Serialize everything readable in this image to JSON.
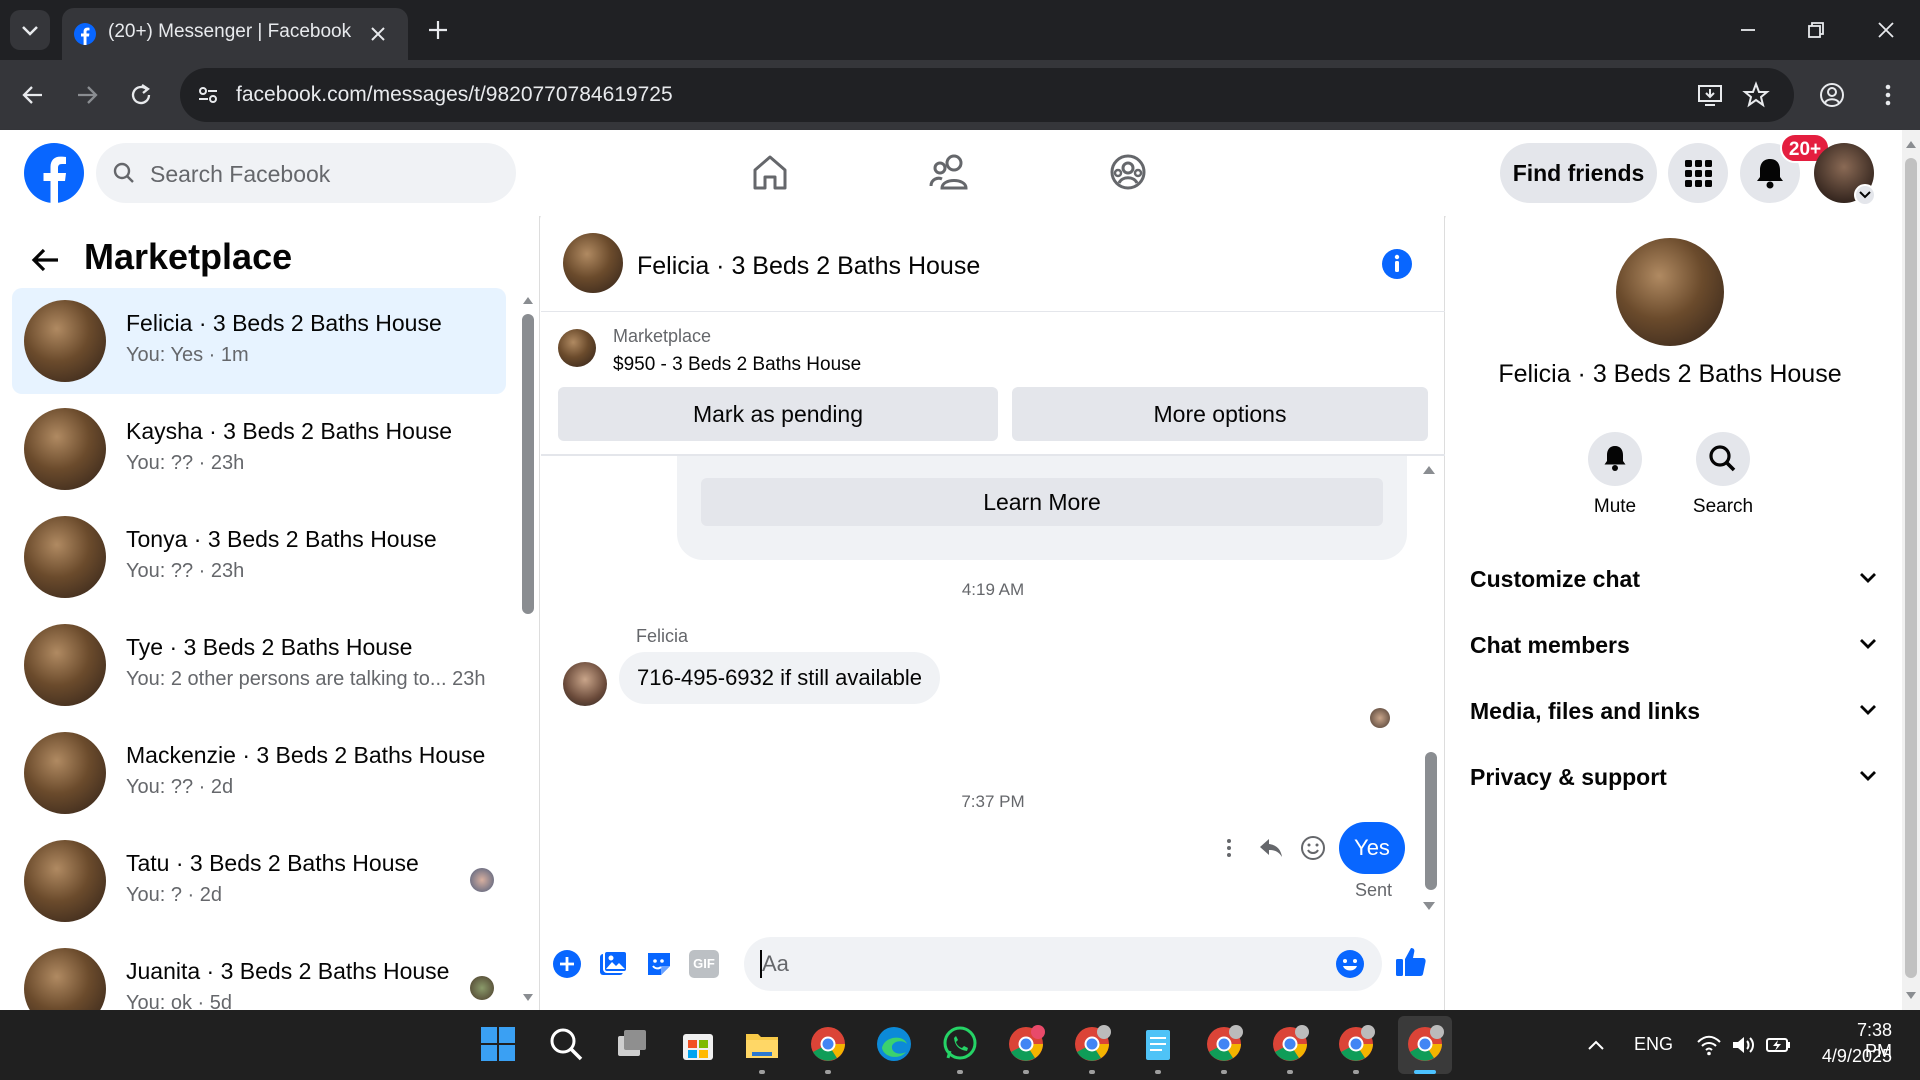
{
  "browser": {
    "tab_title": "(20+) Messenger | Facebook",
    "url": "facebook.com/messages/t/9820770784619725"
  },
  "header": {
    "search_placeholder": "Search Facebook",
    "find_friends": "Find friends",
    "notification_count": "20+"
  },
  "left_panel": {
    "heading": "Marketplace",
    "conversations": [
      {
        "name": "Felicia · 3 Beds 2 Baths House",
        "preview": "You: Yes · 1m",
        "active": true
      },
      {
        "name": "Kaysha · 3 Beds 2 Baths House",
        "preview": "You: ?? · 23h"
      },
      {
        "name": "Tonya · 3 Beds 2 Baths House",
        "preview": "You: ?? · 23h"
      },
      {
        "name": "Tye · 3 Beds 2 Baths House",
        "preview": "You: 2 other persons are talking to... 23h"
      },
      {
        "name": "Mackenzie · 3 Beds 2 Baths House",
        "preview": "You: ?? · 2d"
      },
      {
        "name": "Tatu · 3 Beds 2 Baths House",
        "preview": "You: ? · 2d"
      },
      {
        "name": "Juanita · 3 Beds 2 Baths House",
        "preview": "You: ok · 5d"
      }
    ]
  },
  "chat": {
    "title": "Felicia · 3 Beds 2 Baths House",
    "marketplace_label": "Marketplace",
    "listing": "$950 - 3 Beds 2 Baths House",
    "mark_pending": "Mark as pending",
    "more_options": "More options",
    "learn_more": "Learn More",
    "time1": "4:19 AM",
    "sender": "Felicia",
    "incoming_message": "716-495-6932 if still available",
    "time2": "7:37 PM",
    "outgoing_message": "Yes",
    "sent_status": "Sent",
    "composer_placeholder": "Aa",
    "gif_label": "GIF"
  },
  "right_panel": {
    "name": "Felicia · 3 Beds 2 Baths House",
    "mute": "Mute",
    "search": "Search",
    "sections": [
      "Customize chat",
      "Chat members",
      "Media, files and links",
      "Privacy & support"
    ]
  },
  "taskbar": {
    "lang": "ENG",
    "time": "7:38 PM",
    "date": "4/9/2025"
  },
  "colors": {
    "fb_blue": "#0866ff",
    "active_conv_bg": "#e7f3ff",
    "badge_red": "#e41e3f"
  }
}
